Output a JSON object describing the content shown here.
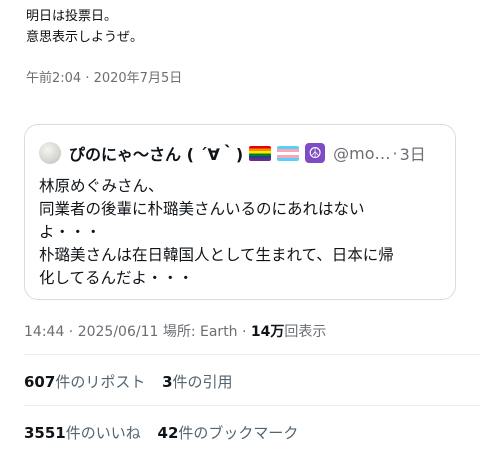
{
  "previous_tweet": {
    "lines": [
      "明日は投票日。",
      "意思表示しようぜ。"
    ],
    "timestamp": "午前2:04 · 2020年7月5日"
  },
  "quote": {
    "display_name": "ぴのにゃ〜さん ( ´∀｀)",
    "handle": "@mo…",
    "separator": "·",
    "date": "3日",
    "peace_symbol": "☮",
    "body_lines": [
      "林原めぐみさん、",
      "同業者の後輩に朴璐美さんいるのにあれはない",
      "よ・・・",
      "朴璐美さんは在日韓国人として生まれて、日本に帰",
      "化してるんだよ・・・"
    ]
  },
  "meta": {
    "time_date": "14:44 · 2025/06/11",
    "location_label": " 場所: Earth · ",
    "views_value": "14万",
    "views_label": "回表示"
  },
  "stats": {
    "reposts_count": "607",
    "reposts_label": "件のリポスト",
    "quotes_count": "3",
    "quotes_label": "件の引用",
    "likes_count": "3551",
    "likes_label": "件のいいね",
    "bookmarks_count": "42",
    "bookmarks_label": "件のブックマーク"
  },
  "colors": {
    "text_primary": "#0f1419",
    "text_secondary": "#6b6f73",
    "border": "#d8dde1",
    "peace_bg": "#7d4bc3"
  },
  "icons": {
    "flag1": "rainbow-flag-icon",
    "flag2": "transgender-flag-icon",
    "peace": "peace-symbol-icon"
  }
}
